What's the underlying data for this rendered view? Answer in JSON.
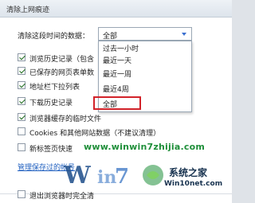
{
  "dialog": {
    "title": "清除上网痕迹"
  },
  "time_range": {
    "label": "清除这段时间的数据：",
    "selected": "全部",
    "options": [
      "过去一小时",
      "最近一天",
      "最近一周",
      "最近4周",
      "全部"
    ]
  },
  "checkbox_items": [
    {
      "label": "浏览历史记录（包含",
      "checked": true
    },
    {
      "label": "已保存的网页表单数",
      "checked": true
    },
    {
      "label": "地址栏下拉列表",
      "checked": true
    },
    {
      "label": "下载历史记录",
      "checked": true
    },
    {
      "label": "浏览器缓存的临时文件",
      "checked": true
    },
    {
      "label": "Cookies 和其他网站数据（不建议清理）",
      "checked": false
    },
    {
      "label": "新标签页快速",
      "checked": false
    },
    {
      "label": "退出浏览器时完全清",
      "checked": false
    }
  ],
  "link": {
    "label": "管理保存过的帐号"
  },
  "watermark": {
    "url_text": "www.winwin7zhijia.com",
    "name": "系统之家",
    "url2": "Win10net.com"
  },
  "colors": {
    "accent": "#3a6fd0",
    "highlight_box": "#d2232a",
    "watermark_green": "#1f8f3a"
  }
}
